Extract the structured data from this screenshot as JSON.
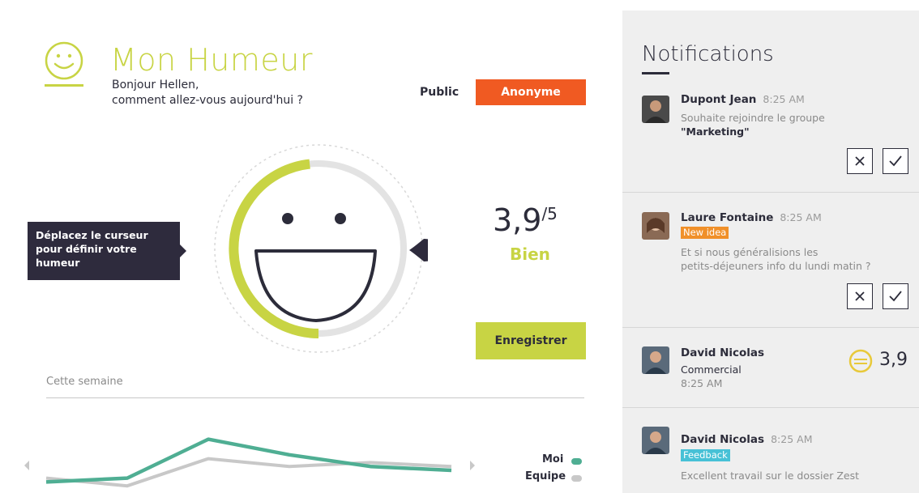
{
  "header": {
    "title": "Mon Humeur",
    "greeting_line1": "Bonjour Hellen,",
    "greeting_line2": "comment allez-vous aujourd'hui ?",
    "public_label": "Public",
    "anonymous_button": "Anonyme"
  },
  "mood": {
    "tooltip_line1": "Déplacez le curseur",
    "tooltip_line2": "pour définir votre",
    "tooltip_line3": "humeur",
    "score": "3,9",
    "score_max": "/5",
    "score_value": 3.9,
    "label": "Bien",
    "save_button": "Enregistrer"
  },
  "week": {
    "label": "Cette semaine",
    "legend_moi": "Moi",
    "legend_equipe": "Equipe"
  },
  "chart_data": {
    "type": "line",
    "series": [
      {
        "name": "Moi",
        "values": [
          3.2,
          3.3,
          4.3,
          3.9,
          3.6,
          3.5
        ]
      },
      {
        "name": "Equipe",
        "values": [
          3.3,
          3.1,
          3.8,
          3.6,
          3.7,
          3.6
        ]
      }
    ],
    "ylim": [
      3.0,
      4.5
    ],
    "colors": {
      "Moi": "#4fae93",
      "Equipe": "#c8c8c8"
    }
  },
  "notifications": {
    "title": "Notifications",
    "items": [
      {
        "name": "Dupont Jean",
        "time": "8:25 AM",
        "line1": "Souhaite rejoindre le groupe",
        "line2": "\"Marketing\"",
        "actions": [
          "close-icon",
          "check-icon"
        ]
      },
      {
        "name": "Laure Fontaine",
        "time": "8:25 AM",
        "tag": "New idea",
        "tag_color": "#f0902a",
        "line1": "Et si nous généralisions les",
        "line2": "petits-déjeuners info du lundi matin ?",
        "actions": [
          "close-icon",
          "check-icon"
        ]
      },
      {
        "name": "David Nicolas",
        "line1": "Commercial",
        "time": "8:25 AM",
        "mood_score": "3,9"
      },
      {
        "name": "David Nicolas",
        "time": "8:25 AM",
        "tag": "Feedback",
        "tag_color": "#47c1d6",
        "line1": "Excellent travail sur le dossier Zest"
      }
    ]
  },
  "colors": {
    "accent": "#c8d444",
    "alert": "#f05a22",
    "dark": "#2e2b3d",
    "panel": "#efefef"
  }
}
